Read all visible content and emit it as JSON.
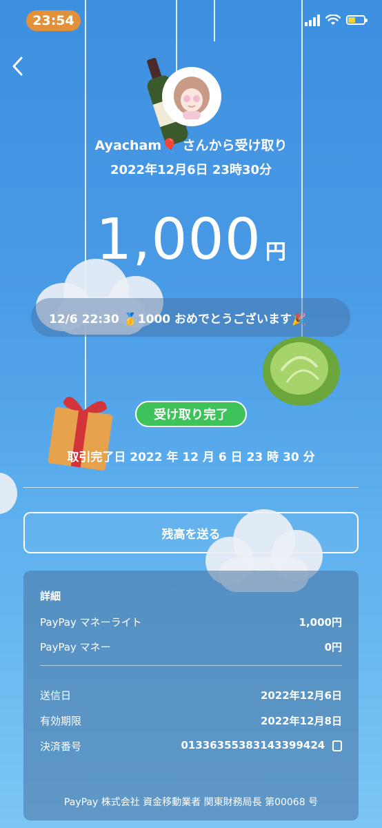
{
  "status_bar": {
    "time": "23:54"
  },
  "transaction": {
    "sender_text": "Ayacham🎈 さんから受け取り",
    "datetime": "2022年12月6日 23時30分",
    "amount": "1,000",
    "currency": "円",
    "message": "12/6 22:30 🥇1000 おめでとうございます🎉",
    "status": "受け取り完了",
    "completed_text": "取引完了日 2022 年 12 月 6 日 23 時 30 分"
  },
  "actions": {
    "send_balance": "残高を送る"
  },
  "details": {
    "title": "詳細",
    "rows": [
      {
        "label": "PayPay マネーライト",
        "value": "1,000円"
      },
      {
        "label": "PayPay マネー",
        "value": "0円"
      }
    ],
    "info": [
      {
        "label": "送信日",
        "value": "2022年12月6日"
      },
      {
        "label": "有効期限",
        "value": "2022年12月8日"
      },
      {
        "label": "決済番号",
        "value": "01336355383143399424"
      }
    ],
    "footer": "PayPay 株式会社 資金移動業者 関東財務局長 第00068 号"
  },
  "icons": [
    "back-chevron-icon",
    "signal-icon",
    "wifi-icon",
    "battery-icon",
    "copy-icon"
  ],
  "colors": {
    "accent_green": "#3ec25a",
    "time_pill": "#e0913a"
  }
}
